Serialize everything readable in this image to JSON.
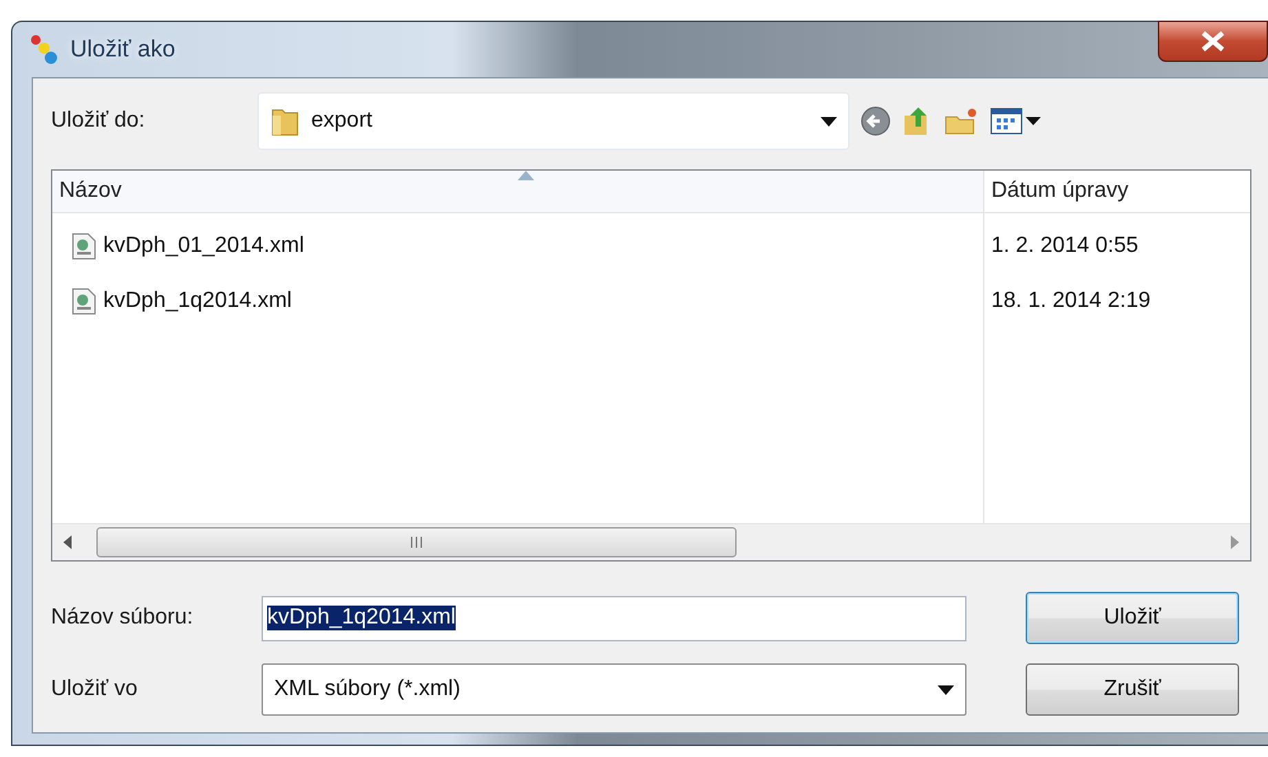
{
  "window": {
    "title": "Uložiť ako"
  },
  "location": {
    "label": "Uložiť do:",
    "value": "export"
  },
  "file_list": {
    "columns": [
      {
        "label": "Názov",
        "sorted": true
      },
      {
        "label": "Dátum úpravy",
        "sorted": false
      }
    ],
    "rows": [
      {
        "name": "kvDph_01_2014.xml",
        "date": "1. 2. 2014 0:55"
      },
      {
        "name": "kvDph_1q2014.xml",
        "date": "18. 1. 2014 2:19"
      }
    ]
  },
  "filename": {
    "label": "Názov súboru:",
    "value": "kvDph_1q2014.xml",
    "text_selected": true
  },
  "filetype": {
    "label": "Uložiť vo",
    "value": "XML súbory (*.xml)"
  },
  "buttons": [
    {
      "label": "Uložiť",
      "default": true
    },
    {
      "label": "Zrušiť",
      "default": false
    }
  ]
}
